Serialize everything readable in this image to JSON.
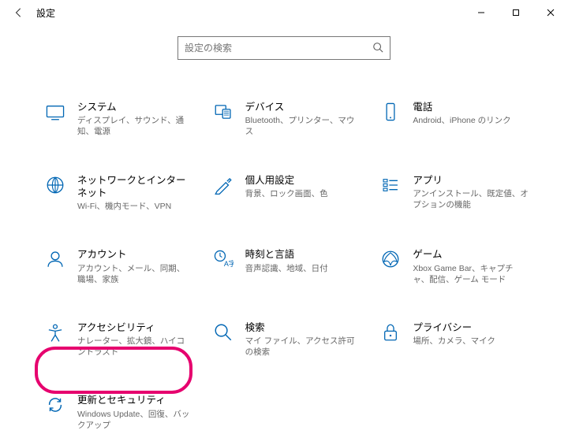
{
  "window": {
    "title": "設定"
  },
  "search": {
    "placeholder": "設定の検索"
  },
  "tiles": {
    "system": {
      "title": "システム",
      "desc": "ディスプレイ、サウンド、通知、電源"
    },
    "devices": {
      "title": "デバイス",
      "desc": "Bluetooth、プリンター、マウス"
    },
    "phone": {
      "title": "電話",
      "desc": "Android、iPhone のリンク"
    },
    "network": {
      "title": "ネットワークとインターネット",
      "desc": "Wi-Fi、機内モード、VPN"
    },
    "personal": {
      "title": "個人用設定",
      "desc": "背景、ロック画面、色"
    },
    "apps": {
      "title": "アプリ",
      "desc": "アンインストール、既定値、オプションの機能"
    },
    "accounts": {
      "title": "アカウント",
      "desc": "アカウント、メール、同期、職場、家族"
    },
    "time": {
      "title": "時刻と言語",
      "desc": "音声認識、地域、日付"
    },
    "gaming": {
      "title": "ゲーム",
      "desc": "Xbox Game Bar、キャプチャ、配信、ゲーム モード"
    },
    "access": {
      "title": "アクセシビリティ",
      "desc": "ナレーター、拡大鏡、ハイコントラスト"
    },
    "searchc": {
      "title": "検索",
      "desc": "マイ ファイル、アクセス許可の検索"
    },
    "privacy": {
      "title": "プライバシー",
      "desc": "場所、カメラ、マイク"
    },
    "update": {
      "title": "更新とセキュリティ",
      "desc": "Windows Update、回復、バックアップ"
    }
  }
}
